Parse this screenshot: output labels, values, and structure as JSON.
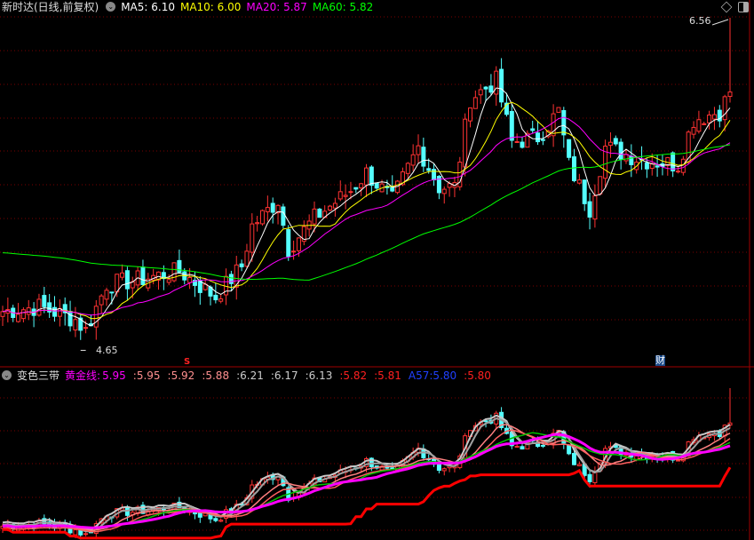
{
  "main_panel": {
    "title": "新时达(日线,前复权)",
    "indicators": [
      {
        "label": "MA5: 6.10",
        "color": "#ffffff"
      },
      {
        "label": "MA10: 6.00",
        "color": "#ffff00"
      },
      {
        "label": "MA20: 5.87",
        "color": "#ff00ff"
      },
      {
        "label": "MA60: 5.82",
        "color": "#00ff00"
      }
    ],
    "high_label": "6.56",
    "low_label": "4.65",
    "marker_s": "S",
    "marker_cai": "财"
  },
  "sub_panel": {
    "title": "变色三带",
    "line_name": "黄金线:",
    "values": [
      {
        "label": "5.95",
        "color": "#ff00ff"
      },
      {
        "label": ":5.95",
        "color": "#ff9090"
      },
      {
        "label": ":5.92",
        "color": "#ff9090"
      },
      {
        "label": ":5.88",
        "color": "#ff9090"
      },
      {
        "label": ":6.21",
        "color": "#cccccc"
      },
      {
        "label": ":6.17",
        "color": "#cccccc"
      },
      {
        "label": ":6.13",
        "color": "#cccccc"
      },
      {
        "label": ":5.82",
        "color": "#ff2020"
      },
      {
        "label": ":5.81",
        "color": "#ff2020"
      },
      {
        "label": "A57:5.80",
        "color": "#2040ff"
      },
      {
        "label": ":5.80",
        "color": "#ff2020"
      }
    ]
  },
  "colors": {
    "up": "#ff3232",
    "down": "#54ffff",
    "grid": "#7a0000",
    "ma5": "#ffffff",
    "ma10": "#ffff00",
    "ma20": "#ff00ff",
    "ma60": "#00ff00"
  },
  "chart_data": {
    "type": "candlestick",
    "price_range": [
      4.65,
      6.56
    ],
    "price_path": [
      [
        0,
        4.74
      ],
      [
        7,
        4.77
      ],
      [
        14,
        4.69
      ],
      [
        16,
        4.62
      ],
      [
        20,
        4.91
      ],
      [
        25,
        4.93
      ],
      [
        34,
        4.99
      ],
      [
        41,
        4.83
      ],
      [
        46,
        5.02
      ],
      [
        48,
        5.27
      ],
      [
        53,
        5.43
      ],
      [
        55,
        5.13
      ],
      [
        60,
        5.32
      ],
      [
        67,
        5.49
      ],
      [
        70,
        5.6
      ],
      [
        75,
        5.43
      ],
      [
        80,
        5.76
      ],
      [
        84,
        5.51
      ],
      [
        87,
        5.51
      ],
      [
        90,
        6.06
      ],
      [
        95,
        6.17
      ],
      [
        98,
        5.79
      ],
      [
        103,
        5.82
      ],
      [
        107,
        5.98
      ],
      [
        109,
        5.65
      ],
      [
        113,
        5.38
      ],
      [
        116,
        5.76
      ],
      [
        123,
        5.68
      ],
      [
        130,
        5.65
      ],
      [
        133,
        5.93
      ],
      [
        138,
        5.98
      ],
      [
        140,
        6.1
      ]
    ],
    "last_high": 6.56
  }
}
